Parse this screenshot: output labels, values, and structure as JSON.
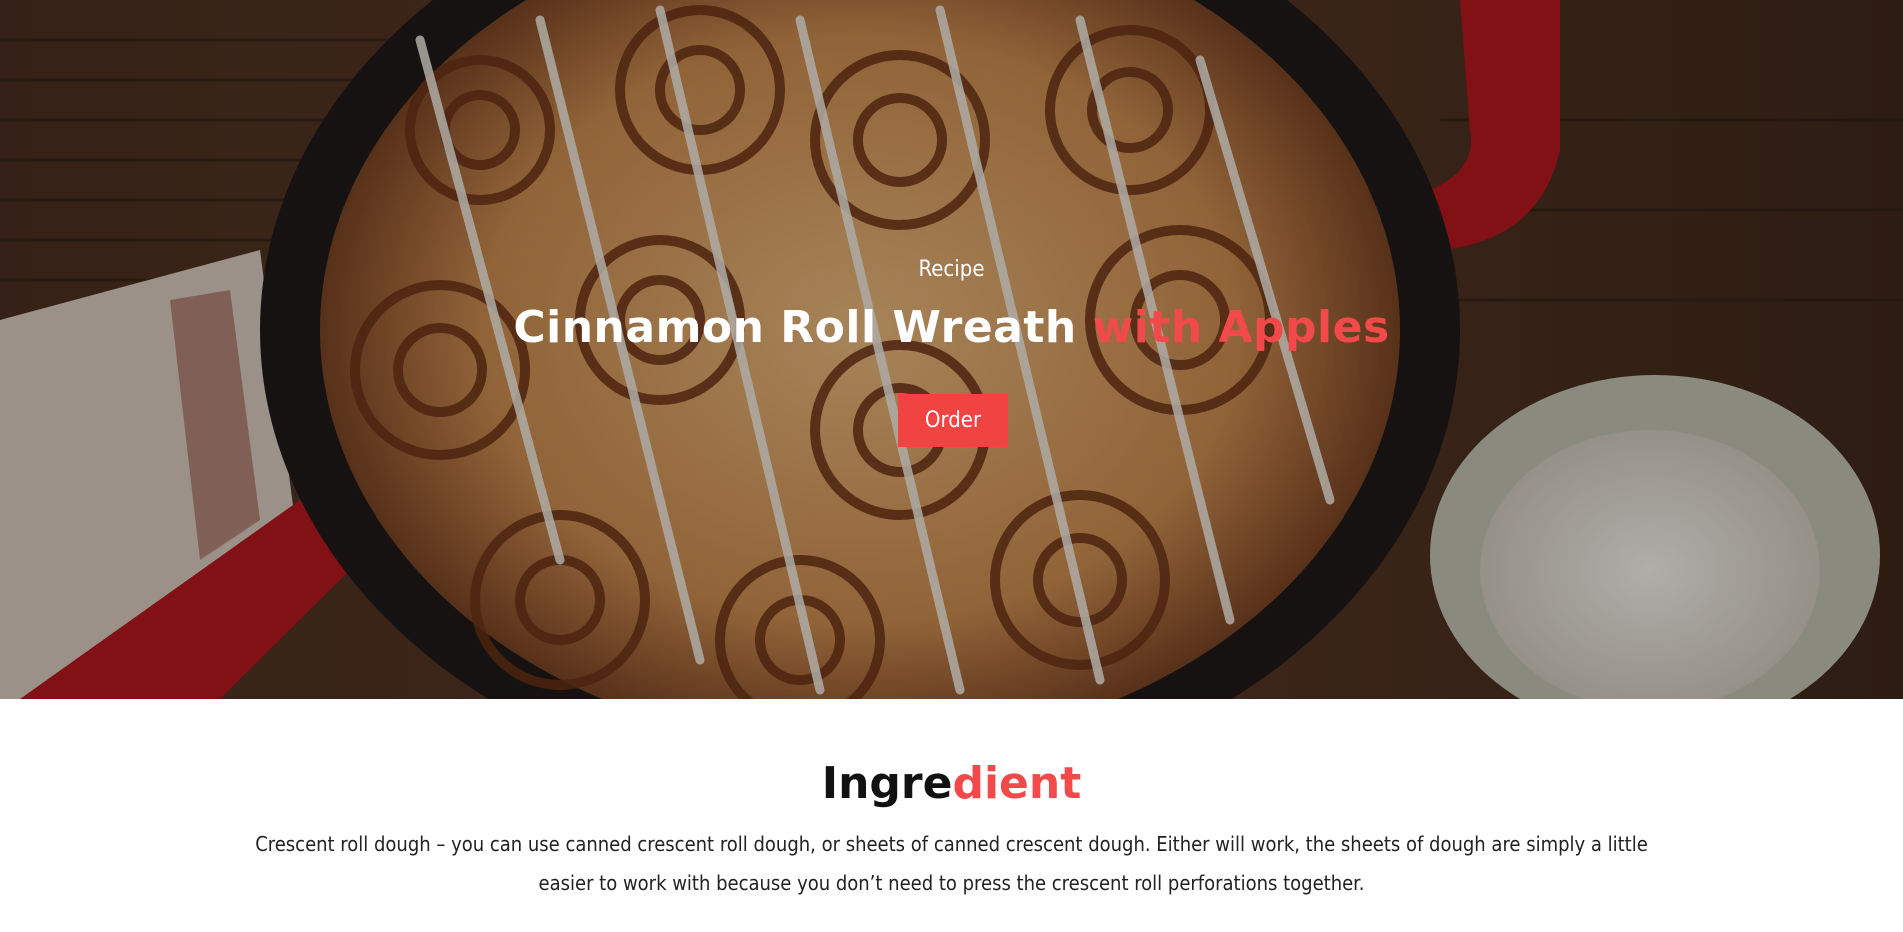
{
  "hero": {
    "eyebrow": "Recipe",
    "title_main": "Cinnamon Roll Wreath ",
    "title_accent": "with Apples",
    "order_label": "Order",
    "photo": "cinnamon-rolls-in-red-skillet-photo"
  },
  "ingredient": {
    "title_main": "Ingre",
    "title_accent": "dient",
    "body": "Crescent roll dough – you can use canned crescent roll dough, or sheets of canned crescent dough. Either will work, the sheets of dough are simply a little easier to work with because you don’t need to press the crescent roll perforations together."
  },
  "colors": {
    "accent": "#f24a4a",
    "button": "#f24343",
    "text_dark": "#111111"
  }
}
